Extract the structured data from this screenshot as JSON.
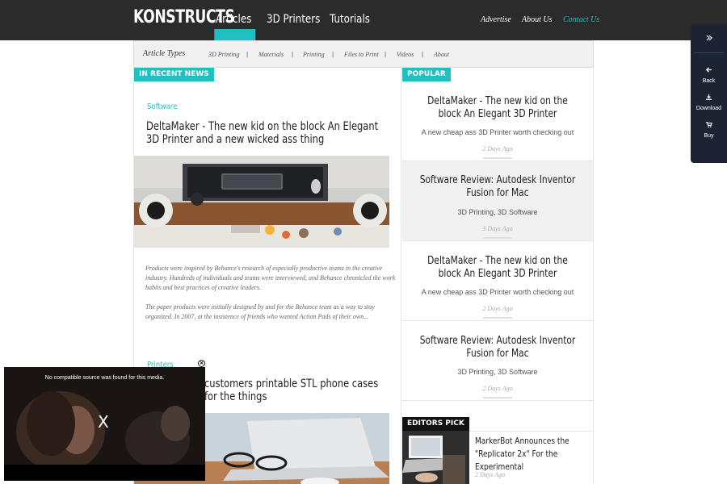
{
  "header": {
    "logo": "KONSTRUCTS",
    "nav": [
      {
        "label": "Articles"
      },
      {
        "label": "3D Printers"
      },
      {
        "label": "Tutorials"
      }
    ],
    "util": [
      {
        "label": "Advertise"
      },
      {
        "label": "About Us"
      },
      {
        "label": "Contact Us"
      }
    ]
  },
  "subnav": {
    "title": "Article Types",
    "items": [
      "3D Printing",
      "Materials",
      "Printing",
      "Files to Print",
      "Videos",
      "About"
    ]
  },
  "recent": {
    "tag": "IN RECENT NEWS",
    "articles": [
      {
        "category": "Software",
        "title": "DeltaMaker - The new kid on the block An Elegant 3D Printer and a new wicked ass thing",
        "p1": "Products were inspired by Behance's research of especially productive teams in the creative industry. Hundreds of individuals and teams were interviewed, and Behance chronicled the work habits and best practices of creative leaders.",
        "p2": "The paper products were initially designed by and for the Behance team as a way to stay organized. In 2007, at the insistence of friends who wanted Action Pads of their own..."
      },
      {
        "category": "Printers",
        "title": "customers printable STL phone cases for the things"
      }
    ]
  },
  "popular": {
    "tag": "POPULAR",
    "items": [
      {
        "title": "DeltaMaker - The new kid on the block An Elegant 3D Printer",
        "sub": "A new cheap ass 3D Printer worth checking out",
        "date": "2 Days Ago"
      },
      {
        "title": "Software Review: Autodesk Inventor Fusion for Mac",
        "sub": "3D Printing, 3D Software",
        "date": "3 Days Ago"
      },
      {
        "title": "DeltaMaker - The new kid on the block An Elegant 3D Printer",
        "sub": "A new cheap ass 3D Printer worth checking out",
        "date": "2 Days Ago"
      },
      {
        "title": "Software Review: Autodesk Inventor Fusion for Mac",
        "sub": "3D Printing, 3D Software",
        "date": "2 Days Ago"
      }
    ]
  },
  "editors_pick": {
    "tag": "EDITORS PICK",
    "title": "MarkerBot Announces the \"Replicator 2x\" For the Experimental",
    "date": "2 Days Ago"
  },
  "sidepanel": {
    "expand_icon": "double-chevron-right-icon",
    "buttons": [
      {
        "icon": "arrow-left-icon",
        "label": "Back"
      },
      {
        "icon": "download-icon",
        "label": "Download"
      },
      {
        "icon": "cart-icon",
        "label": "Buy"
      }
    ]
  },
  "video": {
    "message": "No compatible source was found for this media.",
    "x_label": "X",
    "close_icon": "close-icon"
  },
  "colors": {
    "accent": "#1fc0c0",
    "header_bg": "#2b2b2b",
    "panel_bg": "#1c2433"
  }
}
